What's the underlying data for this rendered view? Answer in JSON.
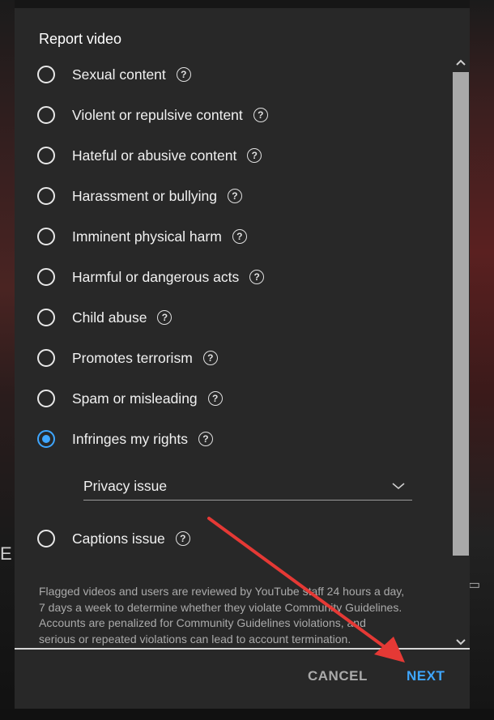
{
  "dialog": {
    "title": "Report video",
    "options": [
      {
        "label": "Sexual content",
        "checked": false
      },
      {
        "label": "Violent or repulsive content",
        "checked": false
      },
      {
        "label": "Hateful or abusive content",
        "checked": false
      },
      {
        "label": "Harassment or bullying",
        "checked": false
      },
      {
        "label": "Imminent physical harm",
        "checked": false
      },
      {
        "label": "Harmful or dangerous acts",
        "checked": false
      },
      {
        "label": "Child abuse",
        "checked": false
      },
      {
        "label": "Promotes terrorism",
        "checked": false
      },
      {
        "label": "Spam or misleading",
        "checked": false
      },
      {
        "label": "Infringes my rights",
        "checked": true
      },
      {
        "label": "Captions issue",
        "checked": false
      }
    ],
    "help_glyph": "?",
    "sub_select": {
      "value": "Privacy issue"
    },
    "disclaimer": [
      "Flagged videos and users are reviewed by YouTube staff 24 hours a day,",
      "7 days a week to determine whether they violate Community Guidelines.",
      "Accounts are penalized for Community Guidelines violations, and",
      "serious or repeated violations can lead to account termination."
    ],
    "cancel_label": "CANCEL",
    "next_label": "NEXT"
  },
  "background": {
    "left_glyph": "E"
  },
  "colors": {
    "dialog_bg": "#282828",
    "accent": "#3ea6ff",
    "annotation_arrow": "#e53935"
  },
  "annotation": {
    "type": "arrow",
    "points_to": "next-button"
  }
}
